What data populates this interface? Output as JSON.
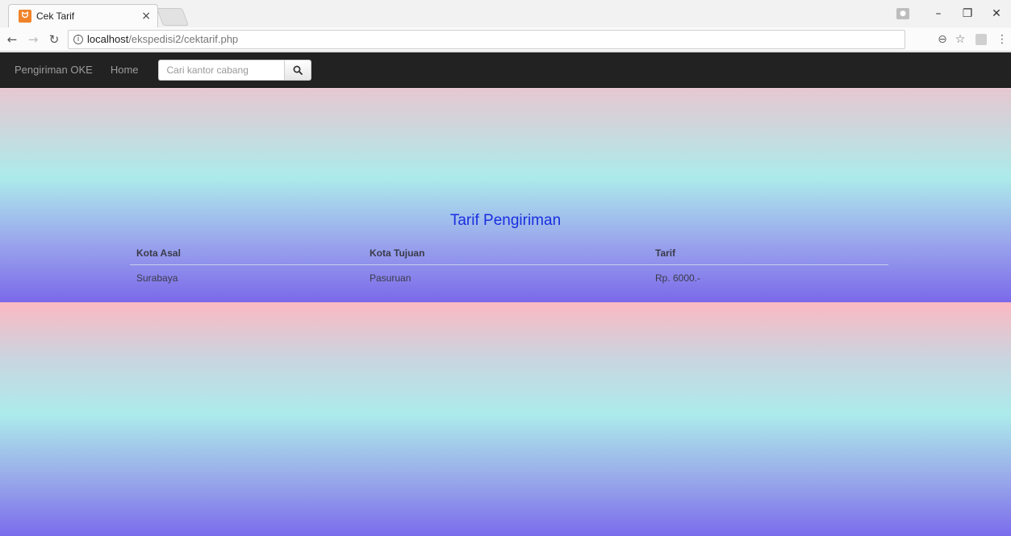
{
  "browser": {
    "tab_title": "Cek Tarif",
    "tab_close": "×",
    "url_host": "localhost",
    "url_path": "/ekspedisi2/cektarif.php"
  },
  "navbar": {
    "brand": "Pengiriman OKE",
    "home": "Home",
    "search_placeholder": "Cari kantor cabang"
  },
  "main": {
    "title": "Tarif Pengiriman",
    "table": {
      "headers": [
        "Kota Asal",
        "Kota Tujuan",
        "Tarif"
      ],
      "rows": [
        [
          "Surabaya",
          "Pasuruan",
          "Rp. 6000.-"
        ]
      ]
    }
  },
  "colors": {
    "navbar_bg": "#222222",
    "heading": "#1a2ee0",
    "favicon": "#f0832a"
  }
}
